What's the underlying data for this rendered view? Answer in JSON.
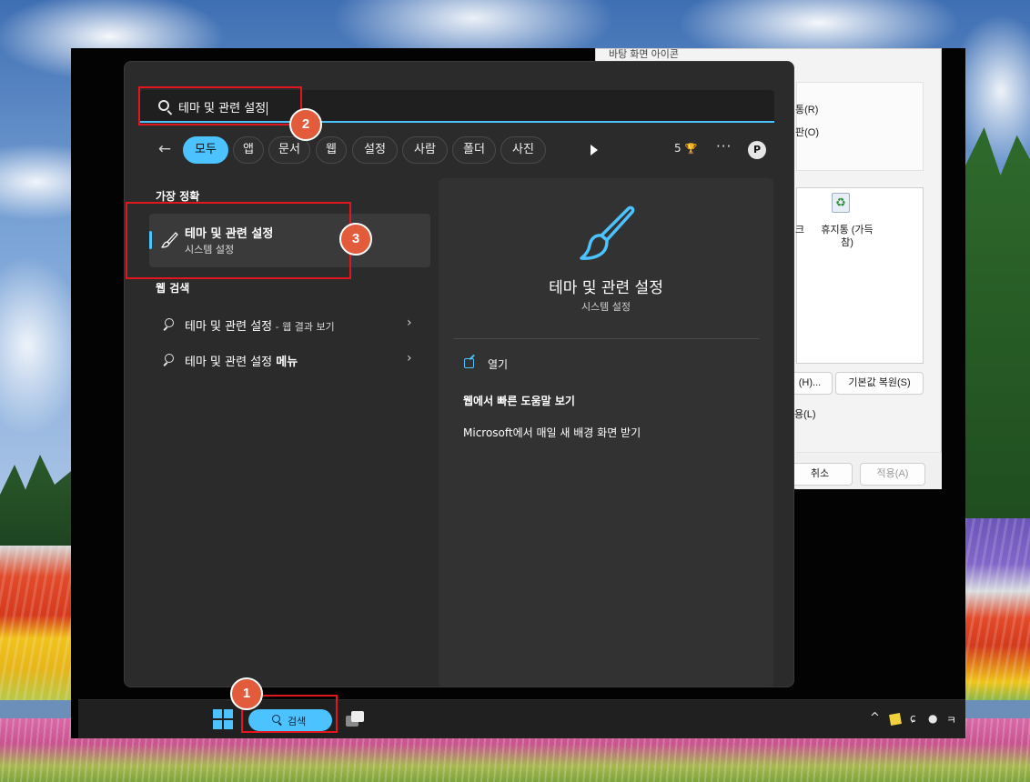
{
  "bg_dialog": {
    "top_label": "바탕 화면 아이콘",
    "option1": "통(R)",
    "option2": "판(O)",
    "icon_partial": "크",
    "recycle_label_line1": "휴지통 (가득",
    "recycle_label_line2": "참)",
    "change_icon_button": "(H)...",
    "restore_default_button": "기본값 복원(S)",
    "allow_label": "용(L)",
    "cancel_button": "취소",
    "apply_button": "적용(A)"
  },
  "search": {
    "query": "테마 및 관련 설정",
    "filters": {
      "back_label": "←",
      "chips": [
        {
          "label": "모두",
          "active": true
        },
        {
          "label": "앱",
          "active": false
        },
        {
          "label": "문서",
          "active": false
        },
        {
          "label": "웹",
          "active": false
        },
        {
          "label": "설정",
          "active": false
        },
        {
          "label": "사람",
          "active": false
        },
        {
          "label": "폴더",
          "active": false
        },
        {
          "label": "사진",
          "active": false
        }
      ],
      "points": "5",
      "points_icon": "🏆",
      "more": "···",
      "profile_initial": "P"
    },
    "best_match": {
      "section_label": "가장 정확",
      "title": "테마 및 관련 설정",
      "subtitle": "시스템 설정",
      "icon": "paintbrush-icon"
    },
    "web_search": {
      "section_label": "웹 검색",
      "items": [
        {
          "text": "테마 및 관련 설정",
          "suffix": " - 웹 결과 보기"
        },
        {
          "text": "테마 및 관련 설정 ",
          "bold_suffix": "메뉴"
        }
      ]
    },
    "preview": {
      "title": "테마 및 관련 설정",
      "subtitle": "시스템 설정",
      "open_label": "열기",
      "help_label": "웹에서 빠른 도움말 보기",
      "ms_label": "Microsoft에서 매일 새 배경 화면 받기"
    }
  },
  "taskbar": {
    "search_label": "검색",
    "tray_up": "^"
  },
  "annotations": {
    "badge1": "1",
    "badge2": "2",
    "badge3": "3"
  },
  "colors": {
    "accent": "#4cc2ff",
    "menu_bg": "#2b2b2b",
    "annotation_red": "#e2161f",
    "badge_orange": "#e25b3b"
  }
}
